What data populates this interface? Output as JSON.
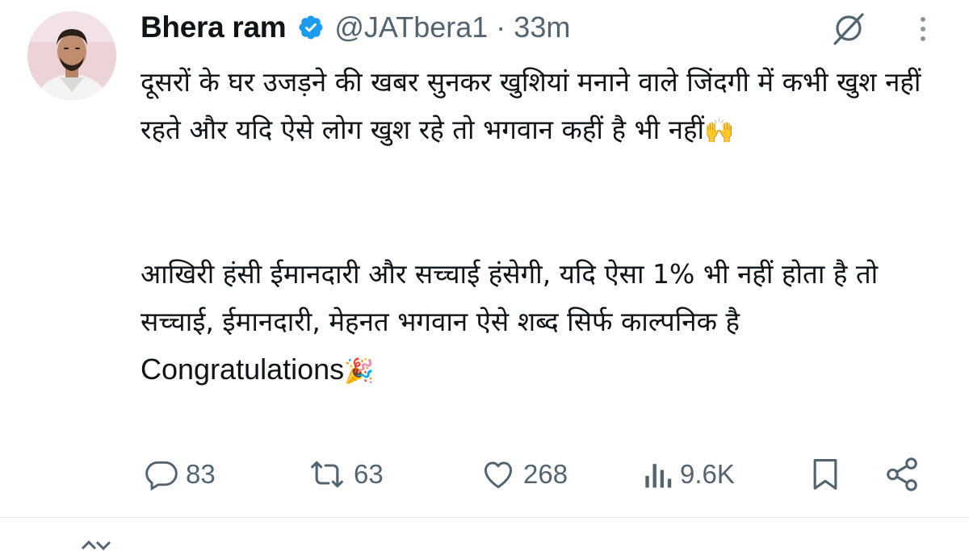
{
  "tweet": {
    "display_name": "Bhera ram",
    "handle": "@JATbera1",
    "separator": "·",
    "time": "33m",
    "verified": true,
    "avatar_icon": "user-avatar-photo",
    "paragraph1": "दूसरों के घर उजड़ने की खबर सुनकर खुशियां मनाने वाले जिंदगी में कभी खुश नहीं रहते और यदि ऐसे लोग खुश रहे तो भगवान कहीं है भी नहीं",
    "paragraph1_emoji": "🙌",
    "paragraph2": "आखिरी हंसी ईमानदारी और सच्चाई हंसेगी, यदि ऐसा 1% भी नहीं होता है तो सच्चाई, ईमानदारी, मेहनत भगवान ऐसे शब्द सिर्फ काल्पनिक है",
    "paragraph3": "Congratulations",
    "paragraph3_emoji": "🎉"
  },
  "actions": {
    "replies": "83",
    "reposts": "63",
    "likes": "268",
    "views": "9.6K"
  },
  "icons": {
    "grok": "grok-icon",
    "more": "more-vertical-icon",
    "reply": "reply-icon",
    "repost": "repost-icon",
    "like": "heart-icon",
    "views": "views-icon",
    "bookmark": "bookmark-icon",
    "share": "share-icon"
  },
  "colors": {
    "text": "#0f1419",
    "secondary": "#536471",
    "verified": "#1d9bf0",
    "divider": "#e4e8eb"
  }
}
